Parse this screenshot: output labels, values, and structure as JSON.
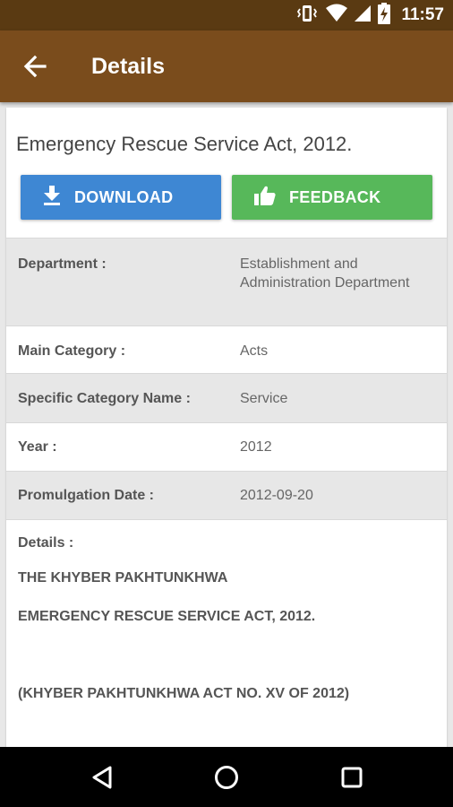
{
  "status_bar": {
    "time": "11:57",
    "icons": [
      "vibrate-icon",
      "wifi-icon",
      "signal-icon",
      "battery-charging-icon"
    ]
  },
  "app_bar": {
    "title": "Details",
    "back_icon": "arrow-back-icon"
  },
  "document": {
    "title": "Emergency Rescue Service Act, 2012."
  },
  "actions": {
    "download_label": "DOWNLOAD",
    "download_icon": "download-icon",
    "feedback_label": "FEEDBACK",
    "feedback_icon": "thumbs-up-icon",
    "download_color": "#3e87d3",
    "feedback_color": "#57b85a"
  },
  "fields": [
    {
      "label": "Department :",
      "value": "Establishment and Administration Department"
    },
    {
      "label": "Main Category :",
      "value": "Acts"
    },
    {
      "label": "Specific Category Name :",
      "value": "Service"
    },
    {
      "label": "Year :",
      "value": "2012"
    },
    {
      "label": "Promulgation Date :",
      "value": "2012-09-20"
    }
  ],
  "details": {
    "label": "Details :",
    "lines": [
      "THE KHYBER PAKHTUNKHWA",
      "EMERGENCY RESCUE SERVICE ACT, 2012.",
      "(KHYBER PAKHTUNKHWA ACT NO. XV OF 2012)"
    ]
  },
  "nav_bar": {
    "buttons": [
      "back-triangle-icon",
      "home-circle-icon",
      "recents-square-icon"
    ]
  },
  "colors": {
    "status_bar": "#5a3a12",
    "app_bar": "#7a4c1c",
    "row_shade": "#e7e7e7"
  }
}
